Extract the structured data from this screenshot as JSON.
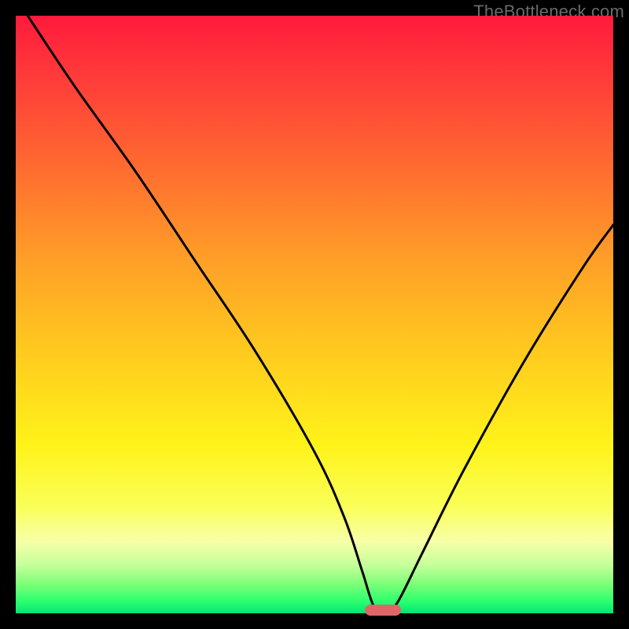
{
  "watermark": "TheBottleneck.com",
  "chart_data": {
    "type": "line",
    "title": "",
    "xlabel": "",
    "ylabel": "",
    "xlim": [
      0,
      100
    ],
    "ylim": [
      0,
      100
    ],
    "grid": false,
    "legend": false,
    "series": [
      {
        "name": "bottleneck-curve",
        "x": [
          2,
          10,
          20,
          30,
          40,
          50,
          55,
          58,
          60,
          62,
          64,
          68,
          75,
          85,
          95,
          100
        ],
        "values": [
          100,
          88,
          74,
          59,
          44,
          27,
          16,
          7,
          1,
          0,
          2,
          10,
          24,
          42,
          58,
          65
        ]
      }
    ],
    "marker": {
      "x": 61.5,
      "y": 0.5
    },
    "colors": {
      "curve": "#000000",
      "marker": "#e06666",
      "gradient_top": "#ff1a3c",
      "gradient_bottom": "#00e676"
    }
  }
}
